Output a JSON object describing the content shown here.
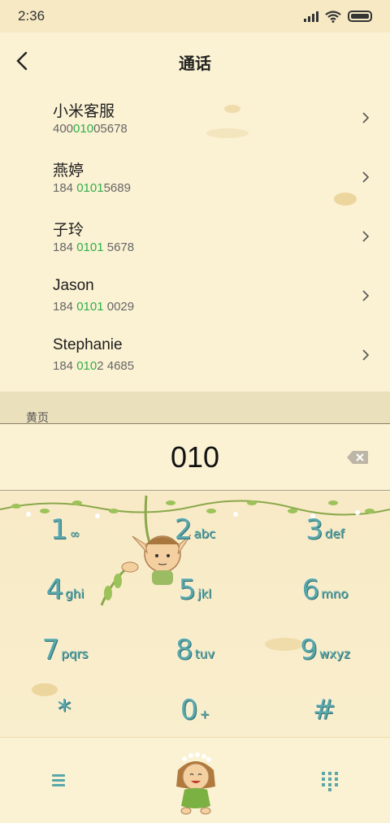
{
  "status_bar": {
    "time": "2:36"
  },
  "header": {
    "title": "通话"
  },
  "contacts": [
    {
      "name": "小米客服",
      "number_pre": "400",
      "number_hl": "010",
      "number_post": "05678"
    },
    {
      "name": "燕婷",
      "number_pre": "184 ",
      "number_hl": "0101",
      "number_post": "5689"
    },
    {
      "name": "子玲",
      "number_pre": "184 ",
      "number_hl": "0101",
      "number_post": " 5678"
    },
    {
      "name": "Jason",
      "number_pre": "184 ",
      "number_hl": "0101",
      "number_post": " 0029"
    },
    {
      "name": "Stephanie",
      "number_pre": "184 ",
      "number_hl": "010",
      "number_post": "2 4685"
    }
  ],
  "yellow_pages": {
    "label": "黄页"
  },
  "dialer": {
    "digits": "010"
  },
  "dialpad": {
    "keys": [
      {
        "digit": "1",
        "letters": "∞"
      },
      {
        "digit": "2",
        "letters": "abc"
      },
      {
        "digit": "3",
        "letters": "def"
      },
      {
        "digit": "4",
        "letters": "ghi"
      },
      {
        "digit": "5",
        "letters": "jkl"
      },
      {
        "digit": "6",
        "letters": "mno"
      },
      {
        "digit": "7",
        "letters": "pqrs"
      },
      {
        "digit": "8",
        "letters": "tuv"
      },
      {
        "digit": "9",
        "letters": "wxyz"
      },
      {
        "digit": "*",
        "letters": ""
      },
      {
        "digit": "0",
        "letters": "+"
      },
      {
        "digit": "#",
        "letters": ""
      }
    ]
  },
  "colors": {
    "background": "#fbf1d3",
    "highlight": "#2eb04a",
    "key_digit": "#5aa7aa"
  },
  "icons": [
    "back-arrow-icon",
    "chevron-right-icon",
    "backspace-icon",
    "menu-icon",
    "call-elf-icon",
    "dialpad-icon",
    "wifi-icon",
    "battery-icon",
    "signal-icon"
  ]
}
